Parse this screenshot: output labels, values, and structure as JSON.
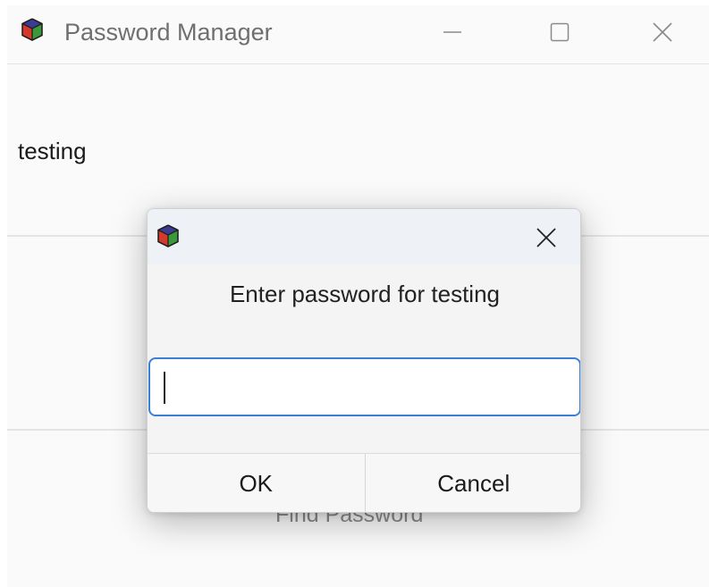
{
  "window": {
    "title": "Password Manager",
    "icon": "tk-cube-icon"
  },
  "main": {
    "entry_label": "testing",
    "find_button_label": "Find Password"
  },
  "dialog": {
    "icon": "tk-cube-icon",
    "prompt": "Enter password for testing",
    "password_value": "",
    "ok_label": "OK",
    "cancel_label": "Cancel"
  },
  "colors": {
    "accent": "#3c7fd6",
    "title_text": "#6f6f6f"
  }
}
